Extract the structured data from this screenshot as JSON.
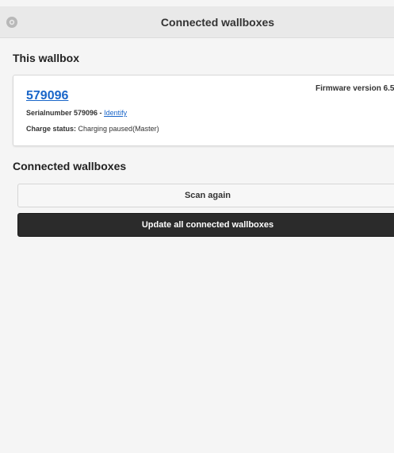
{
  "header": {
    "title": "Connected wallboxes",
    "settings_icon": "gear-icon"
  },
  "this_wallbox": {
    "heading": "This wallbox",
    "id": "579096",
    "firmware": "Firmware version 6.5",
    "serial_prefix": "Serialnumber 579096 - ",
    "identify_label": "Identify",
    "charge_status_label": "Charge status:",
    "charge_status_value": " Charging paused(Master)"
  },
  "connected": {
    "heading": "Connected wallboxes",
    "scan_label": "Scan again",
    "update_label": "Update all connected wallboxes"
  }
}
